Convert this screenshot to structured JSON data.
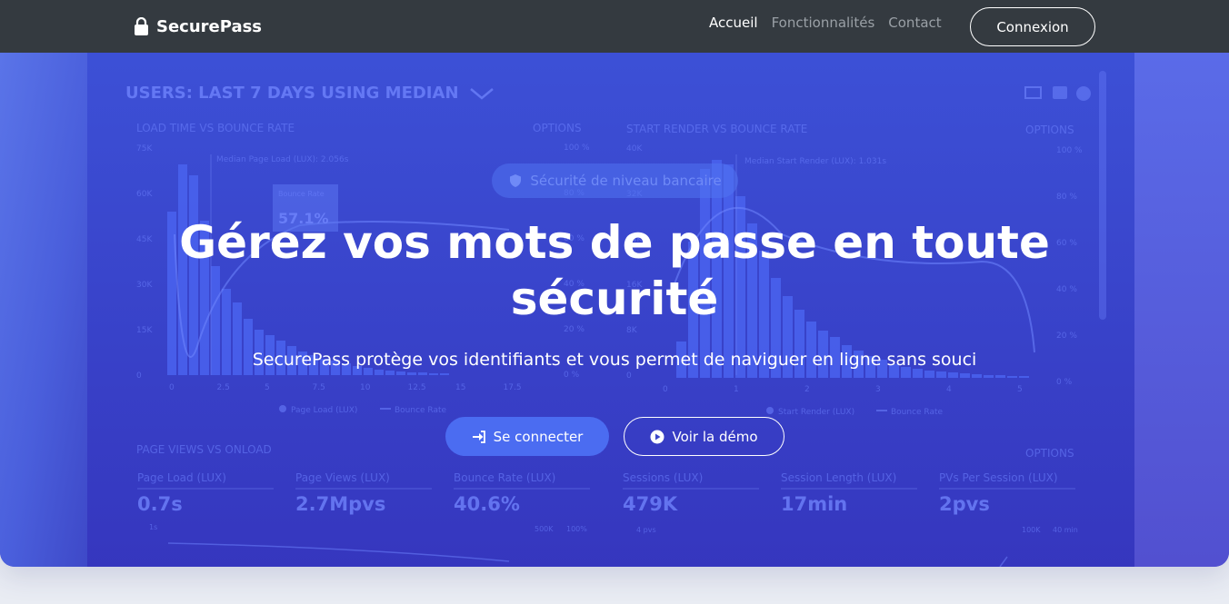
{
  "navbar": {
    "brand": "SecurePass",
    "links": [
      {
        "label": "Accueil",
        "active": true
      },
      {
        "label": "Fonctionnalités",
        "active": false
      },
      {
        "label": "Contact",
        "active": false
      }
    ],
    "login_button": "Connexion"
  },
  "hero": {
    "badge": "Sécurité de niveau bancaire",
    "title": "Gérez vos mots de passe en toute sécurité",
    "subtitle": "SecurePass protège vos identifiants et vous permet de naviguer en ligne sans souci",
    "primary_button": "Se connecter",
    "secondary_button": "Voir la démo",
    "primary_icon": "sign-in-icon",
    "secondary_icon": "play-circle-icon"
  },
  "background_dashboard": {
    "heading": "USERS: LAST 7 DAYS USING MEDIAN",
    "left_chart_title": "LOAD TIME VS BOUNCE RATE",
    "right_chart_title": "START RENDER VS BOUNCE RATE",
    "options_label": "OPTIONS",
    "left_annotation": "Median Page Load (LUX): 2.056s",
    "right_annotation": "Median Start Render (LUX): 1.031s",
    "tooltip_label": "Bounce Rate",
    "tooltip_value": "57.1%",
    "left_yaxis": [
      "75K",
      "60K",
      "45K",
      "30K",
      "15K",
      "0"
    ],
    "left_pct": [
      "100 %",
      "80 %",
      "60 %",
      "40 %",
      "20 %",
      "0 %"
    ],
    "left_xaxis": [
      "0",
      "2.5",
      "5",
      "7.5",
      "10",
      "12.5",
      "15",
      "17.5"
    ],
    "right_yaxis": [
      "40K",
      "32K",
      "24K",
      "16K",
      "8K",
      "0"
    ],
    "right_pct": [
      "100 %",
      "80 %",
      "60 %",
      "40 %",
      "20 %",
      "0 %"
    ],
    "right_xaxis": [
      "0",
      "1",
      "2",
      "3",
      "4",
      "5"
    ],
    "left_legend": [
      "Page Load (LUX)",
      "Bounce Rate"
    ],
    "right_legend": [
      "Start Render (LUX)",
      "Bounce Rate"
    ],
    "section2_title": "PAGE VIEWS VS ONLOAD",
    "metrics": [
      {
        "label": "Page Load (LUX)",
        "value": "0.7s"
      },
      {
        "label": "Page Views (LUX)",
        "value": "2.7Mpvs"
      },
      {
        "label": "Bounce Rate (LUX)",
        "value": "40.6%"
      },
      {
        "label": "Sessions (LUX)",
        "value": "479K"
      },
      {
        "label": "Session Length (LUX)",
        "value": "17min"
      },
      {
        "label": "PVs Per Session (LUX)",
        "value": "2pvs"
      }
    ],
    "small_labels": [
      "1s",
      "500K",
      "100%",
      "4 pvs",
      "100K",
      "40 min"
    ]
  },
  "colors": {
    "navbar_bg": "#343a40",
    "hero_primary": "#3f55d8",
    "button_primary": "#4b6cf1",
    "text_light": "#ffffff",
    "nav_muted": "#9aa0a6"
  }
}
